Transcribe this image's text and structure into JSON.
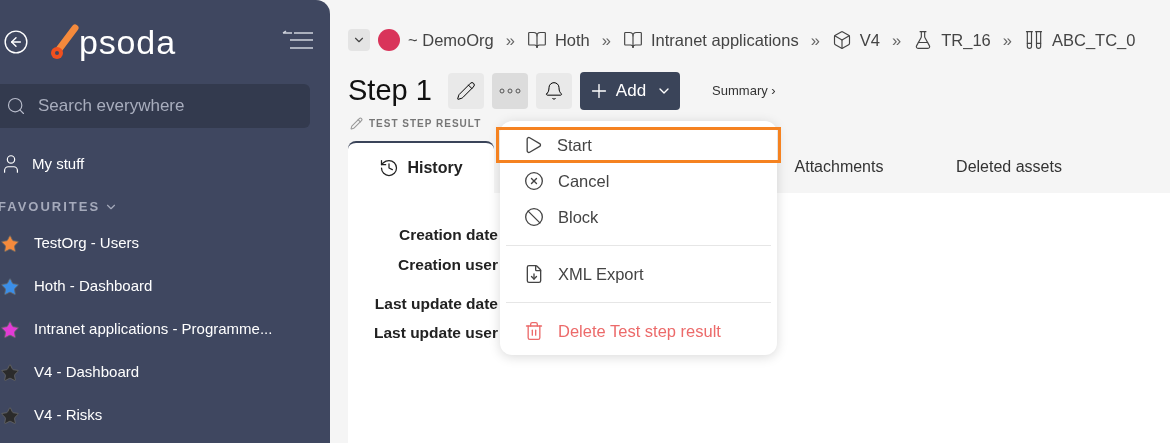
{
  "sidebar": {
    "logo": "psoda",
    "search": {
      "placeholder": "Search everywhere"
    },
    "my_stuff": "My stuff",
    "favourites_heading": "FAVOURITES",
    "favourites": [
      {
        "label": "TestOrg - Users",
        "color": "#f58a3c"
      },
      {
        "label": "Hoth - Dashboard",
        "color": "#3b8ee8"
      },
      {
        "label": "Intranet applications - Programme...",
        "color": "#e23bd6"
      },
      {
        "label": "V4 - Dashboard",
        "color": "#2b2b2b"
      },
      {
        "label": "V4 - Risks",
        "color": "#2b2b2b"
      }
    ]
  },
  "breadcrumbs": [
    {
      "kind": "org",
      "label": "~ DemoOrg"
    },
    {
      "kind": "book",
      "label": "Hoth",
      "separator": "»"
    },
    {
      "kind": "book",
      "label": "Intranet applications",
      "separator": "»"
    },
    {
      "kind": "box",
      "label": "V4",
      "separator": "»"
    },
    {
      "kind": "flask",
      "label": "TR_16",
      "separator": "»"
    },
    {
      "kind": "tubes",
      "label": "ABC_TC_0",
      "separator": "»"
    }
  ],
  "title": "Step 1",
  "add_button": "Add",
  "summary_link": "Summary ›",
  "subtitle": "TEST STEP RESULT",
  "tabs": [
    {
      "label": "History",
      "selected": true
    },
    {
      "label": "Attachments",
      "selected": false
    },
    {
      "label": "Deleted assets",
      "selected": false
    }
  ],
  "fields": [
    "Creation date",
    "Creation user",
    "Last update date",
    "Last update user"
  ],
  "menu": [
    {
      "kind": "play",
      "label": "Start",
      "selected": true
    },
    {
      "kind": "cancel",
      "label": "Cancel",
      "selected": false
    },
    {
      "kind": "block",
      "label": "Block",
      "selected": false
    },
    {
      "kind": "divider"
    },
    {
      "kind": "xml",
      "label": "XML Export",
      "selected": false
    },
    {
      "kind": "divider"
    },
    {
      "kind": "delete",
      "label": "Delete Test step result",
      "selected": false
    }
  ]
}
